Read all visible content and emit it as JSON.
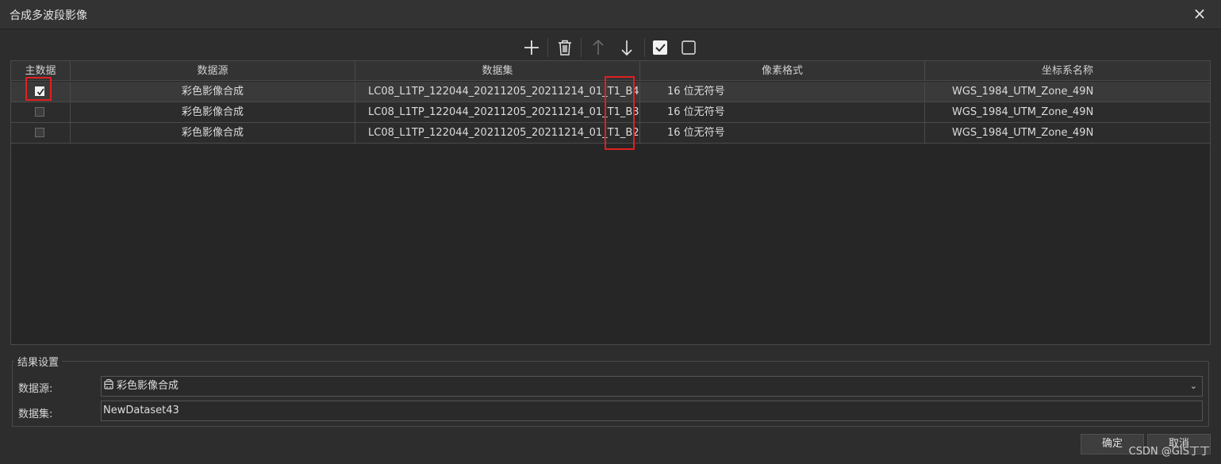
{
  "window": {
    "title": "合成多波段影像",
    "close_icon": "×"
  },
  "toolbar": {
    "icons": [
      "add-icon",
      "delete-icon",
      "move-up-icon",
      "move-down-icon",
      "select-all-icon",
      "deselect-all-icon"
    ]
  },
  "grid": {
    "columns": [
      "主数据",
      "数据源",
      "数据集",
      "像素格式",
      "坐标系名称"
    ],
    "rows": [
      {
        "primary": true,
        "datasource": "彩色影像合成",
        "dataset": "LC08_L1TP_122044_20211205_20211214_01_T1_B4",
        "pixel_format": "16 位无符号",
        "crs": "WGS_1984_UTM_Zone_49N"
      },
      {
        "primary": false,
        "datasource": "彩色影像合成",
        "dataset": "LC08_L1TP_122044_20211205_20211214_01_T1_B3",
        "pixel_format": "16 位无符号",
        "crs": "WGS_1984_UTM_Zone_49N"
      },
      {
        "primary": false,
        "datasource": "彩色影像合成",
        "dataset": "LC08_L1TP_122044_20211205_20211214_01_T1_B2",
        "pixel_format": "16 位无符号",
        "crs": "WGS_1984_UTM_Zone_49N"
      }
    ]
  },
  "result": {
    "group_title": "结果设置",
    "datasource_label": "数据源:",
    "datasource_value": "彩色影像合成",
    "dataset_label": "数据集:",
    "dataset_value": "NewDataset43"
  },
  "buttons": {
    "ok": "确定",
    "cancel": "取消"
  },
  "watermark": "CSDN @GIS丁丁",
  "colors": {
    "background": "#2d2d2d",
    "highlight": "#e02020"
  }
}
